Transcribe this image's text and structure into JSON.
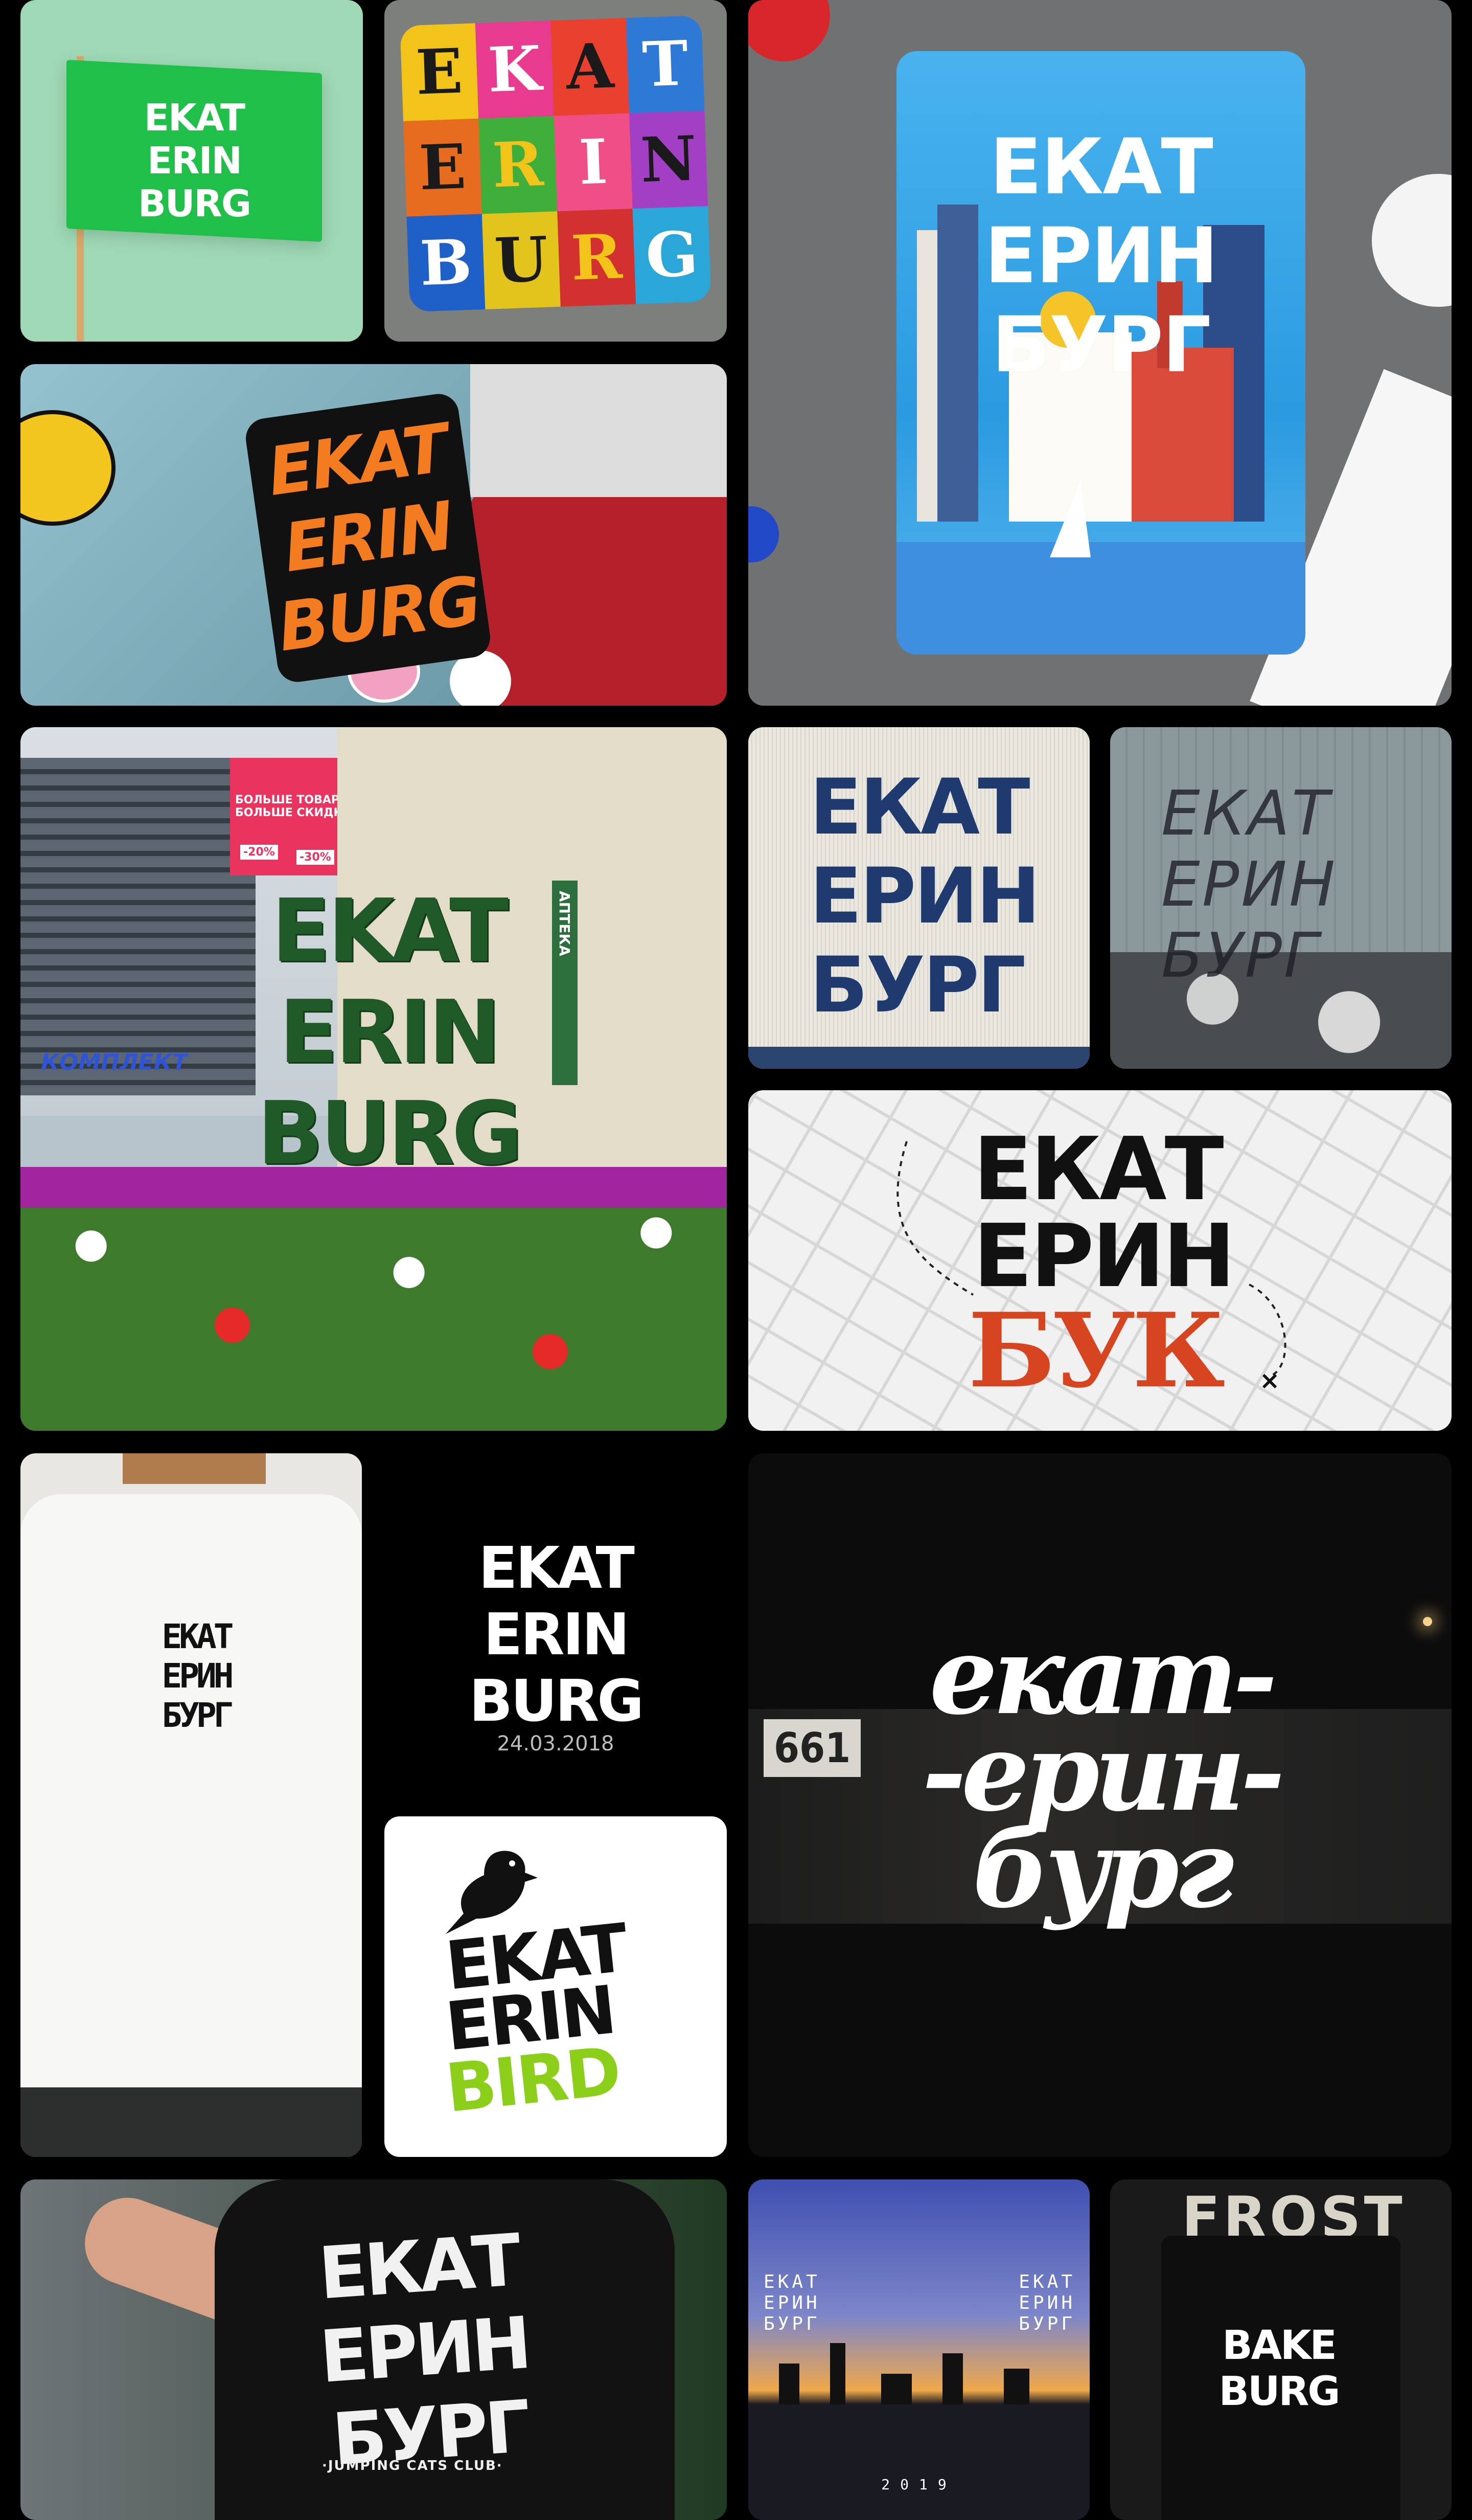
{
  "tiles": {
    "flag": {
      "text": "EKAT\nERIN\nBURG"
    },
    "pillow": {
      "letters": [
        "E",
        "K",
        "A",
        "T",
        "E",
        "R",
        "I",
        "N",
        "B",
        "U",
        "R",
        "G"
      ]
    },
    "card": {
      "text": "ЕКАТ\nЕРИН\nБУРГ"
    },
    "sticker": {
      "text": "EKAT\nERIN\nBURG"
    },
    "square": {
      "text": "EKAT\nERIN\nBURG",
      "sign_apteka": "АПТЕКА",
      "sign_sale": "БОЛЬШЕ ТОВАРОВ\nБОЛЬШЕ СКИДКА",
      "discount1": "-20%",
      "discount2": "-30%",
      "building_sign": "КОМПЛЕКТ"
    },
    "knit": {
      "text": "ЕКАТ\nЕРИН\nБУРГ"
    },
    "graffiti": {
      "text": "ЕКАТ\nЕРИН\nБУРГ"
    },
    "map": {
      "line1": "ЕКАТ",
      "line2": "ЕРИН",
      "line3": "БУК",
      "marker": "×"
    },
    "tshirt": {
      "text": "ЕКАТ\nЕРИН\nБУРГ"
    },
    "event": {
      "text": "EKAT\nERIN\nBURG",
      "date": "24.03.2018"
    },
    "bird": {
      "line1": "EKAT",
      "line2": "ERIN",
      "line3": "BIRD"
    },
    "script": {
      "text": "екат-\n-ерин-\nбург",
      "bus_number": "661"
    },
    "blackshirt": {
      "text": "ЕКАТ\nЕРИН\nБУРГ",
      "club": "·JUMPING CATS CLUB·"
    },
    "sky": {
      "left": "ЕКАТ\nЕРИН\nБУРГ",
      "right": "ЕКАТ\nЕРИН\nБУРГ",
      "year": "2019"
    },
    "bag": {
      "text": "BAKE\nBURG",
      "tag": "FROST"
    }
  },
  "colors": {
    "flag_green": "#1fbf4a",
    "bird_green": "#8ccf1a",
    "map_red": "#d6451f",
    "knit_blue": "#1e3a6e",
    "card_blue": "#2b9ae0"
  }
}
